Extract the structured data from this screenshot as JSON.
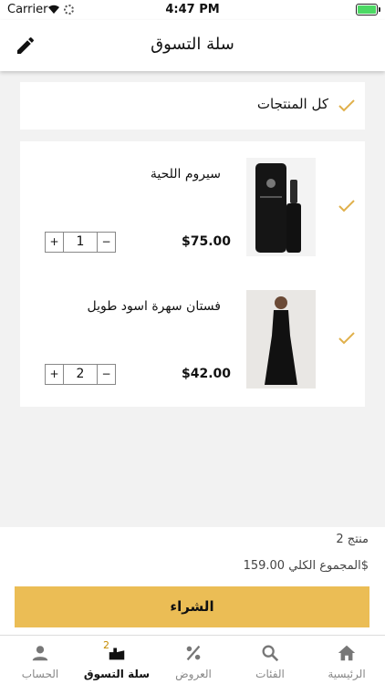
{
  "status_bar": {
    "carrier": "Carrier",
    "time": "4:47 PM"
  },
  "header": {
    "title": "سلة التسوق",
    "edit_icon": "pencil-icon"
  },
  "select_all": {
    "label": "كل المنتجات",
    "checked": true
  },
  "cart": {
    "items": [
      {
        "name": "سيروم اللحية",
        "price": "$75.00",
        "quantity": "1",
        "checked": true
      },
      {
        "name": "فستان سهرة اسود طويل",
        "price": "$42.00",
        "quantity": "2",
        "checked": true
      }
    ],
    "plus": "+",
    "minus": "−"
  },
  "summary": {
    "count_text": "2 منتج",
    "total_text": "المجموع الكلي 159.00$",
    "buy_label": "الشراء"
  },
  "tabs": [
    {
      "label": "الرئيسية",
      "icon": "home-icon"
    },
    {
      "label": "الفئات",
      "icon": "search-icon"
    },
    {
      "label": "العروض",
      "icon": "percent-icon"
    },
    {
      "label": "سلة التسوق",
      "icon": "cart-icon",
      "badge": "2",
      "active": true
    },
    {
      "label": "الحساب",
      "icon": "user-icon"
    }
  ],
  "colors": {
    "accent": "#ebbd55",
    "check": "#e0b04b",
    "background": "#f2f2f2"
  }
}
